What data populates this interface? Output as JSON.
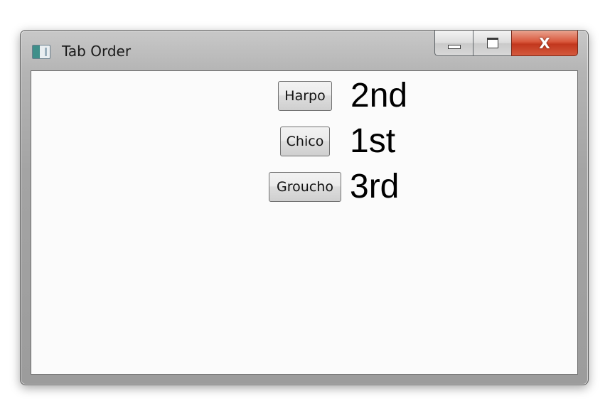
{
  "window": {
    "title": "Tab Order",
    "icon": "window-app-icon",
    "caption": {
      "minimize_icon": "minimize-icon",
      "maximize_icon": "maximize-icon",
      "close_icon": "close-icon",
      "close_glyph": "X"
    }
  },
  "rows": [
    {
      "button_label": "Harpo",
      "order_label": "2nd"
    },
    {
      "button_label": "Chico",
      "order_label": "1st"
    },
    {
      "button_label": "Groucho",
      "order_label": "3rd"
    }
  ],
  "colors": {
    "close_button": "#c2371d",
    "client_background": "#fbfbfb"
  }
}
